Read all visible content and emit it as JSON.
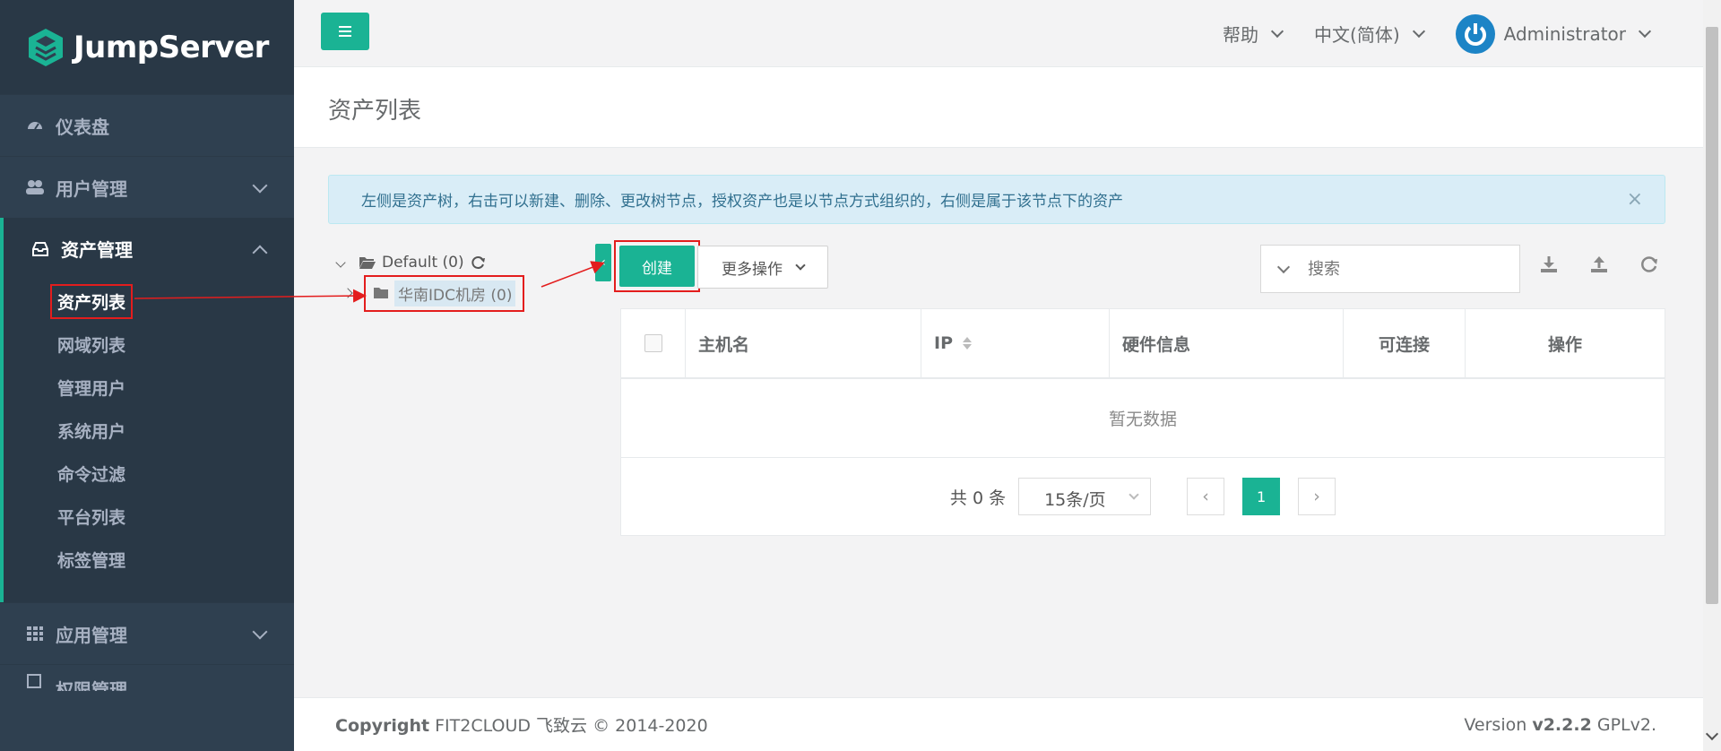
{
  "brand": {
    "name": "JumpServer"
  },
  "sidebar": {
    "items": [
      {
        "label": "仪表盘",
        "icon": "dashboard-icon"
      },
      {
        "label": "用户管理",
        "icon": "users-icon"
      },
      {
        "label": "资产管理",
        "icon": "inbox-icon"
      },
      {
        "label": "应用管理",
        "icon": "grid-icon"
      },
      {
        "label": "权限管理",
        "icon": "permission-icon"
      }
    ],
    "asset_submenu": [
      "资产列表",
      "网域列表",
      "管理用户",
      "系统用户",
      "命令过滤",
      "平台列表",
      "标签管理"
    ]
  },
  "topbar": {
    "help": "帮助",
    "language": "中文(简体)",
    "user": "Administrator"
  },
  "page": {
    "title": "资产列表"
  },
  "alert": {
    "text": "左侧是资产树，右击可以新建、删除、更改树节点，授权资产也是以节点方式组织的，右侧是属于该节点下的资产",
    "close": "×"
  },
  "tree": {
    "root": "Default (0)",
    "child": "华南IDC机房 (0)"
  },
  "toolbar": {
    "create": "创建",
    "more": "更多操作",
    "search_placeholder": "搜索"
  },
  "table": {
    "columns": [
      "主机名",
      "IP",
      "硬件信息",
      "可连接",
      "操作"
    ],
    "empty": "暂无数据"
  },
  "pager": {
    "total": "共 0 条",
    "page_size": "15条/页",
    "current_page": "1"
  },
  "footer": {
    "copyright_label": "Copyright",
    "copyright_text": "FIT2CLOUD 飞致云 © 2014-2020",
    "version_label": "Version",
    "version": "v2.2.2",
    "license": "GPLv2."
  },
  "colors": {
    "accent": "#1ab394",
    "sidebar": "#2f4050",
    "annotation": "#e31d1d"
  }
}
